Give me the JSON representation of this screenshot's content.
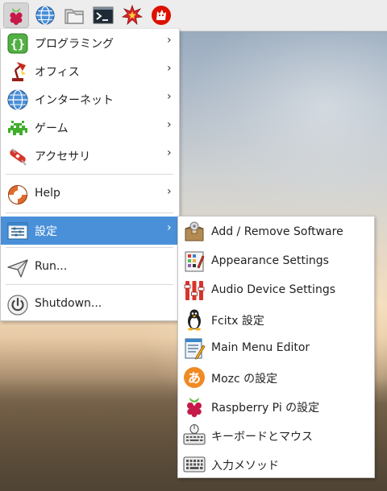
{
  "taskbar": {
    "buttons": [
      {
        "icon": "raspberry-icon"
      },
      {
        "icon": "globe-icon"
      },
      {
        "icon": "folder-icon"
      },
      {
        "icon": "terminal-icon"
      },
      {
        "icon": "burst-icon"
      },
      {
        "icon": "wolfram-icon"
      }
    ]
  },
  "menu": {
    "items": [
      {
        "label": "プログラミング",
        "icon": "programming-icon",
        "has_submenu": true
      },
      {
        "label": "オフィス",
        "icon": "office-icon",
        "has_submenu": true
      },
      {
        "label": "インターネット",
        "icon": "internet-icon",
        "has_submenu": true
      },
      {
        "label": "ゲーム",
        "icon": "game-icon",
        "has_submenu": true
      },
      {
        "label": "アクセサリ",
        "icon": "accessories-icon",
        "has_submenu": true
      },
      {
        "label": "Help",
        "icon": "help-icon",
        "has_submenu": true
      },
      {
        "label": "設定",
        "icon": "settings-icon",
        "has_submenu": true,
        "selected": true
      },
      {
        "label": "Run...",
        "icon": "run-icon",
        "has_submenu": false
      },
      {
        "label": "Shutdown...",
        "icon": "shutdown-icon",
        "has_submenu": false
      }
    ],
    "arrow": "›"
  },
  "submenu": {
    "items": [
      {
        "label": "Add / Remove Software",
        "icon": "package-icon"
      },
      {
        "label": "Appearance Settings",
        "icon": "appearance-icon"
      },
      {
        "label": "Audio Device Settings",
        "icon": "audio-mixer-icon"
      },
      {
        "label": "Fcitx 設定",
        "icon": "penguin-icon"
      },
      {
        "label": "Main Menu Editor",
        "icon": "menu-editor-icon"
      },
      {
        "label": "Mozc の設定",
        "icon": "mozc-icon"
      },
      {
        "label": "Raspberry Pi の設定",
        "icon": "raspberry-pi-config-icon"
      },
      {
        "label": "キーボードとマウス",
        "icon": "keyboard-mouse-icon"
      },
      {
        "label": "入力メソッド",
        "icon": "input-method-icon"
      }
    ]
  },
  "colors": {
    "selection": "#4a90d9",
    "raspberry": "#c51a4a",
    "leaf": "#6cc04a"
  }
}
